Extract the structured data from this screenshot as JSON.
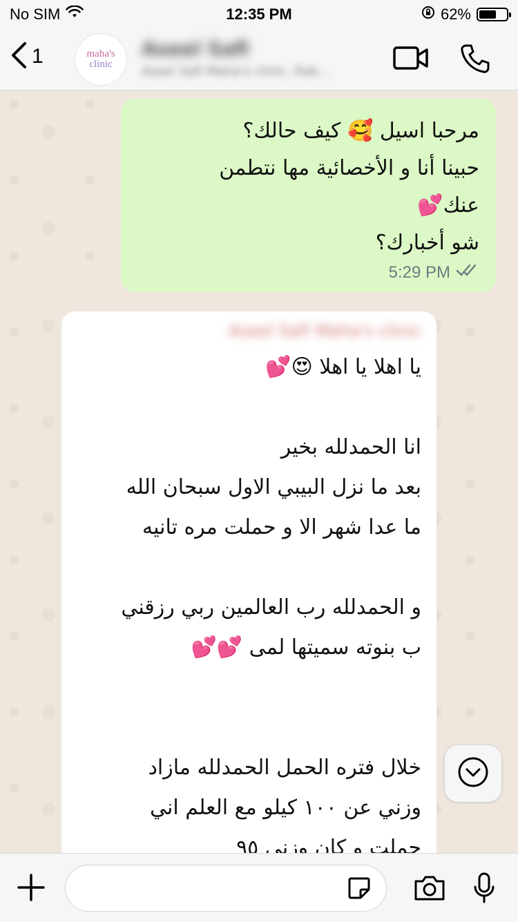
{
  "status_bar": {
    "carrier": "No SIM",
    "time": "12:35 PM",
    "battery_percent": "62%",
    "battery_level": 0.62
  },
  "header": {
    "back_count": "1",
    "avatar_line1": "maha's",
    "avatar_line2": "clinic",
    "contact_name": "Aseel Safi",
    "contact_subtitle": "Aseel Safi Maha's clinic, Dak…",
    "contact_ellipsis": ".."
  },
  "messages": {
    "outgoing": {
      "lines": [
        "مرحبا اسيل 🥰 كيف حالك؟",
        "حبينا أنا و الأخصائية مها نتطمن",
        "عنك💕",
        "شو أخبارك؟"
      ],
      "time": "5:29 PM",
      "status_icon": "double-check-icon"
    },
    "incoming": {
      "sender": "Aseel Safi Maha's clinic",
      "line1": "يا اهلا يا اهلا 😍💕",
      "line2": "انا الحمدلله بخير",
      "line3": "بعد ما نزل البيبي الاول سبحان الله",
      "line4": "ما عدا شهر الا و حملت مره تانيه",
      "line5": "و الحمدلله رب العالمين ربي رزقني",
      "line6": "ب بنوته سميتها لمى 💕💕",
      "line7": "خلال فتره الحمل الحمدلله مازاد",
      "line8": "وزني عن ١٠٠ كيلو مع العلم اني",
      "line9": "حملت و كان وزني ٩٥"
    }
  },
  "input": {
    "placeholder": ""
  },
  "colors": {
    "outgoing_bubble": "#dcf8c6",
    "incoming_bubble": "#ffffff",
    "chat_background": "#efe7dd",
    "bar_background": "#f6f6f6"
  }
}
